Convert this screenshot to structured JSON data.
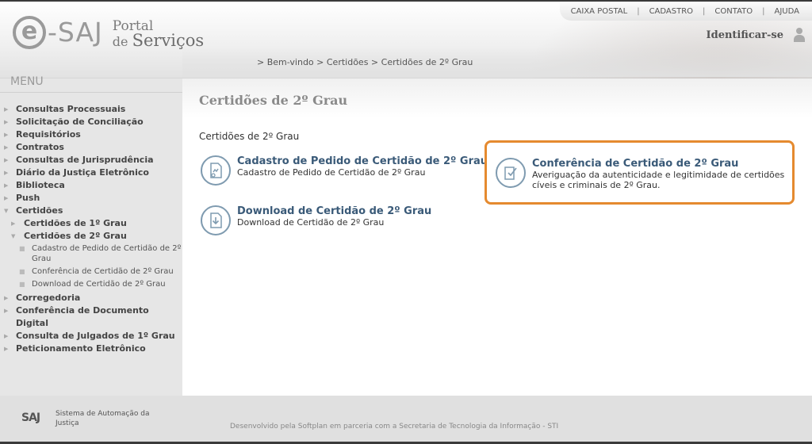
{
  "header": {
    "logo_prefix": "e",
    "logo_brand": "-SAJ",
    "logo_portal_line1": "Portal",
    "logo_portal_line2a": "de",
    "logo_portal_line2b": "Serviços",
    "top_links": [
      "CAIXA POSTAL",
      "CADASTRO",
      "CONTATO",
      "AJUDA"
    ],
    "top_sep": "|",
    "identify_label": "Identificar-se",
    "breadcrumb": "> Bem-vindo > Certidões > Certidões de 2º Grau"
  },
  "sidebar": {
    "title": "MENU",
    "bullet": "▶",
    "bullet_open": "▼",
    "leaf_bullet": "■",
    "items": [
      {
        "label": "Consultas Processuais"
      },
      {
        "label": "Solicitação de Conciliação"
      },
      {
        "label": "Requisitórios"
      },
      {
        "label": "Contratos"
      },
      {
        "label": "Consultas de Jurisprudência"
      },
      {
        "label": "Diário da Justiça Eletrônico"
      },
      {
        "label": "Biblioteca"
      },
      {
        "label": "Push"
      },
      {
        "label": "Certidões"
      },
      {
        "label": "Certidões de 1º Grau"
      },
      {
        "label": "Certidões de 2º Grau"
      },
      {
        "label": "Cadastro de Pedido de Certidão de 2º Grau"
      },
      {
        "label": "Conferência de Certidão de 2º Grau"
      },
      {
        "label": "Download de Certidão de 2º Grau"
      },
      {
        "label": "Corregedoria"
      },
      {
        "label": "Conferência de Documento Digital"
      },
      {
        "label": "Consulta de Julgados de 1º Grau"
      },
      {
        "label": "Peticionamento Eletrônico"
      }
    ]
  },
  "main": {
    "page_title": "Certidões de 2º Grau",
    "section_label": "Certidões de 2º Grau",
    "cards": [
      {
        "title": "Cadastro de Pedido de Certidão de 2º Grau",
        "desc": "Cadastro de Pedido de Certidão de 2º Grau",
        "icon": "certificate-document-icon"
      },
      {
        "title": "Download de Certidão de 2º Grau",
        "desc": "Download de Certidão de 2º Grau",
        "icon": "download-document-icon"
      },
      {
        "title": "Conferência de Certidão de 2º Grau",
        "desc": "Averiguação da autenticidade e legitimidade de certidões cíveis e criminais de 2º Grau.",
        "icon": "check-document-icon"
      }
    ]
  },
  "footer": {
    "logo": "SAJ",
    "system_name": "Sistema de Automação da Justiça",
    "credit": "Desenvolvido pela Softplan em parceria com a Secretaria de Tecnologia da Informação - STI"
  },
  "colors": {
    "highlight_border": "#e58a2f",
    "card_title": "#3a5a78",
    "icon_ring": "#7f9bb0"
  }
}
